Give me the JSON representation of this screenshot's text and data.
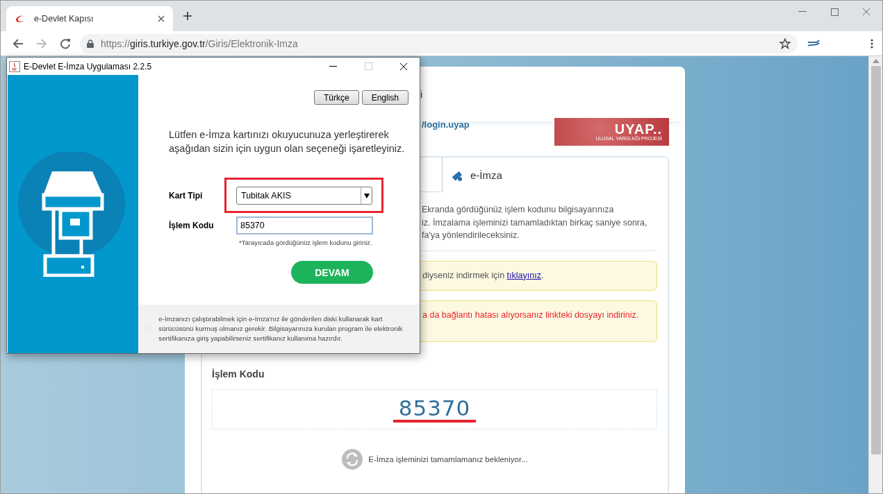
{
  "browser": {
    "tab": {
      "title": "e-Devlet Kapısı"
    },
    "address": {
      "scheme": "https://",
      "host": "giris.turkiye.gov.tr",
      "path": "/Giris/Elektronik-Imza"
    }
  },
  "page": {
    "header_fragment": "i",
    "login_fragment": "/login.uyap",
    "logo": {
      "text": "UYAP..",
      "subtitle": "ULUSAL YARGI AĞI PROJESİ"
    },
    "tabs": [
      {
        "label": "e-İmza",
        "selected": true
      }
    ],
    "instructions": [
      "Ekranda gördüğünüz işlem kodunu bilgisayarınıza",
      "iz. İmzalama işleminizi tamamladıktan birkaç saniye sonra,",
      "fa'ya yönlendirileceksiniz."
    ],
    "alerts": [
      {
        "kind": "info",
        "text": "diyseniz indirmek için ",
        "link": "tıklayınız",
        "after": "."
      },
      {
        "kind": "error",
        "text": "a da bağlantı hatası alıyorsanız linkteki dosyayı indiriniz."
      }
    ],
    "code_section": {
      "label": "İşlem Kodu",
      "code": "85370",
      "status": "E-İmza işleminizi tamamlamanız bekleniyor..."
    }
  },
  "dialog": {
    "title": "E-Devlet E-İmza Uygulaması 2.2.5",
    "languages": [
      "Türkçe",
      "English"
    ],
    "intro": "Lütfen e-İmza kartınızı okuyucunuza yerleştirerek aşağıdan sizin için uygun olan seçeneği işaretleyiniz.",
    "card_type": {
      "label": "Kart Tipi",
      "value": "Tubitak AKIS"
    },
    "code": {
      "label": "İşlem Kodu",
      "value": "85370",
      "hint": "*Tarayıcada gördüğünüz işlem kodunu giriniz."
    },
    "button": "DEVAM",
    "note": "e-İmzanızı çalıştırabilmek için e-İmza'nız ile gönderilen diski kullanarak kart sürücüsünü kurmuş olmanız gerekir. Bilgisayarınıza kurulan program ile elektronik sertifikanıza giriş yapabilirseniz sertifikanız kullanıma hazırdır."
  }
}
